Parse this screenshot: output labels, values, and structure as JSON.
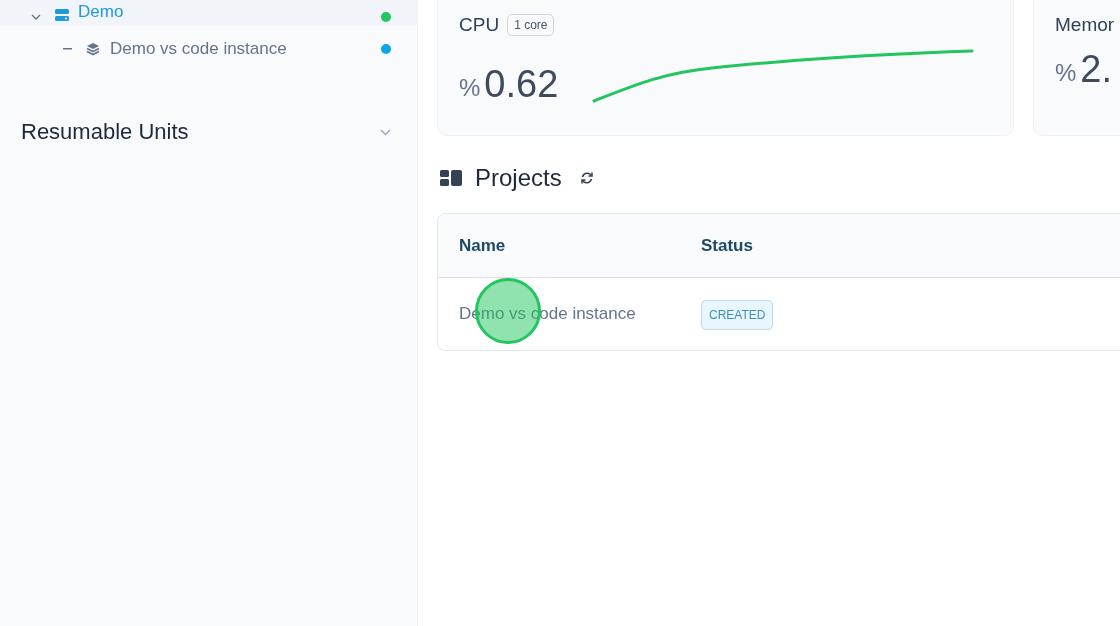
{
  "sidebar": {
    "tree": [
      {
        "label": "Demo",
        "kind": "server",
        "selected": true,
        "expanded": true,
        "color": "#22c55e",
        "children": [
          {
            "label": "Demo vs code instance",
            "kind": "layers",
            "selected": false,
            "color": "#0ea5e9"
          }
        ]
      }
    ],
    "sections": [
      {
        "title": "Resumable Units"
      }
    ]
  },
  "metrics": [
    {
      "title": "CPU",
      "badge": "1 core",
      "unit": "%",
      "value": "0.62",
      "kind": "sparkline"
    },
    {
      "title": "Memor",
      "unit": "%",
      "value": "2."
    }
  ],
  "projects": {
    "title": "Projects",
    "columns": [
      "Name",
      "Status"
    ],
    "rows": [
      {
        "name": "Demo vs code instance",
        "status": "CREATED"
      }
    ]
  },
  "cursor": {
    "kind": "click"
  }
}
